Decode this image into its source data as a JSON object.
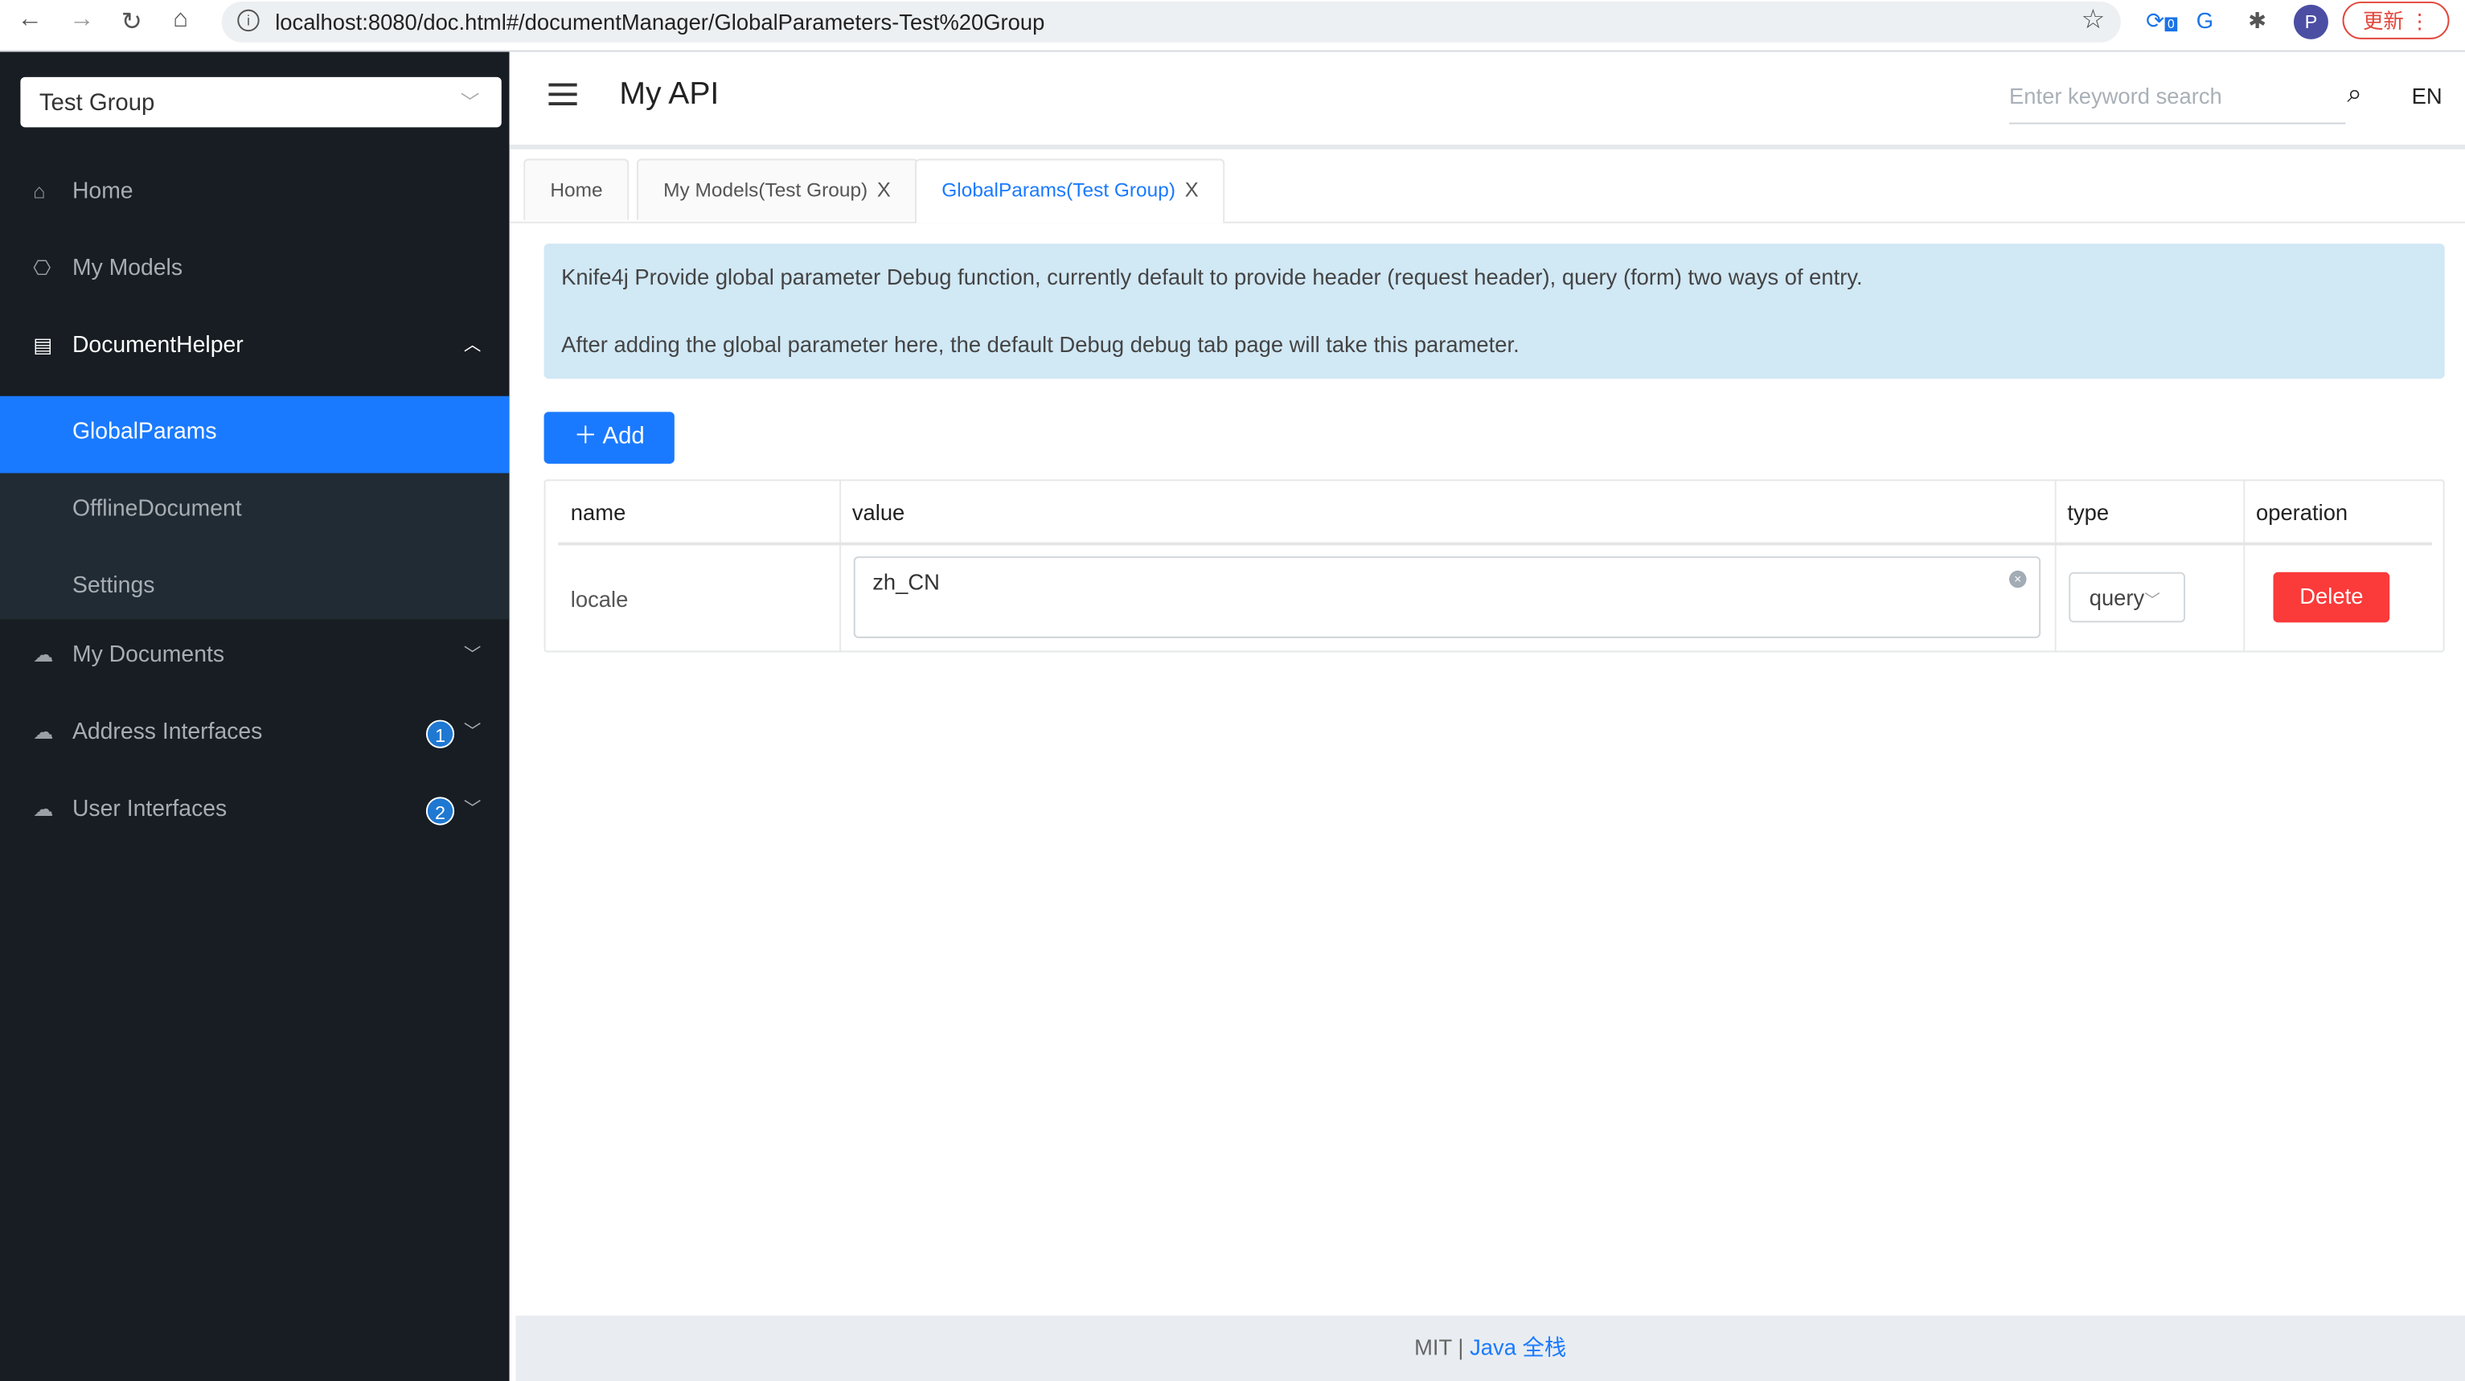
{
  "browser": {
    "url": "localhost:8080/doc.html#/documentManager/GlobalParameters-Test%20Group",
    "profile_initial": "P",
    "update_label": "更新",
    "ext_badge": "0"
  },
  "sidebar": {
    "group_select": "Test Group",
    "items": [
      {
        "label": "Home",
        "icon": "home-icon"
      },
      {
        "label": "My Models",
        "icon": "models-icon"
      },
      {
        "label": "DocumentHelper",
        "icon": "document-settings-icon",
        "expanded": true,
        "children": [
          {
            "label": "GlobalParams",
            "active": true
          },
          {
            "label": "OfflineDocument"
          },
          {
            "label": "Settings"
          }
        ]
      },
      {
        "label": "My Documents",
        "icon": "api-cloud-icon"
      },
      {
        "label": "Address Interfaces",
        "icon": "api-cloud-icon",
        "badge": "1"
      },
      {
        "label": "User Interfaces",
        "icon": "api-cloud-icon",
        "badge": "2"
      }
    ]
  },
  "header": {
    "title": "My API",
    "search_placeholder": "Enter keyword search",
    "lang": "EN"
  },
  "tabs": [
    {
      "label": "Home"
    },
    {
      "label": "My Models(Test Group)",
      "close": "X"
    },
    {
      "label": "GlobalParams(Test Group)",
      "close": "X",
      "active": true
    }
  ],
  "notice": {
    "line1": "Knife4j Provide global parameter Debug function, currently default to provide header (request header), query (form) two ways of entry.",
    "line2": "After adding the global parameter here, the default Debug debug tab page will take this parameter."
  },
  "add_label": "Add",
  "table": {
    "headers": [
      "name",
      "value",
      "type",
      "operation"
    ],
    "rows": [
      {
        "name": "locale",
        "value": "zh_CN",
        "type": "query",
        "action": "Delete"
      }
    ]
  },
  "footer": {
    "license": "MIT | ",
    "link": "Java 全栈"
  },
  "colors": {
    "accent": "#1a7aff",
    "danger": "#fb3a3a",
    "sidebar": "#171d22",
    "notice": "#d1e8f5"
  }
}
